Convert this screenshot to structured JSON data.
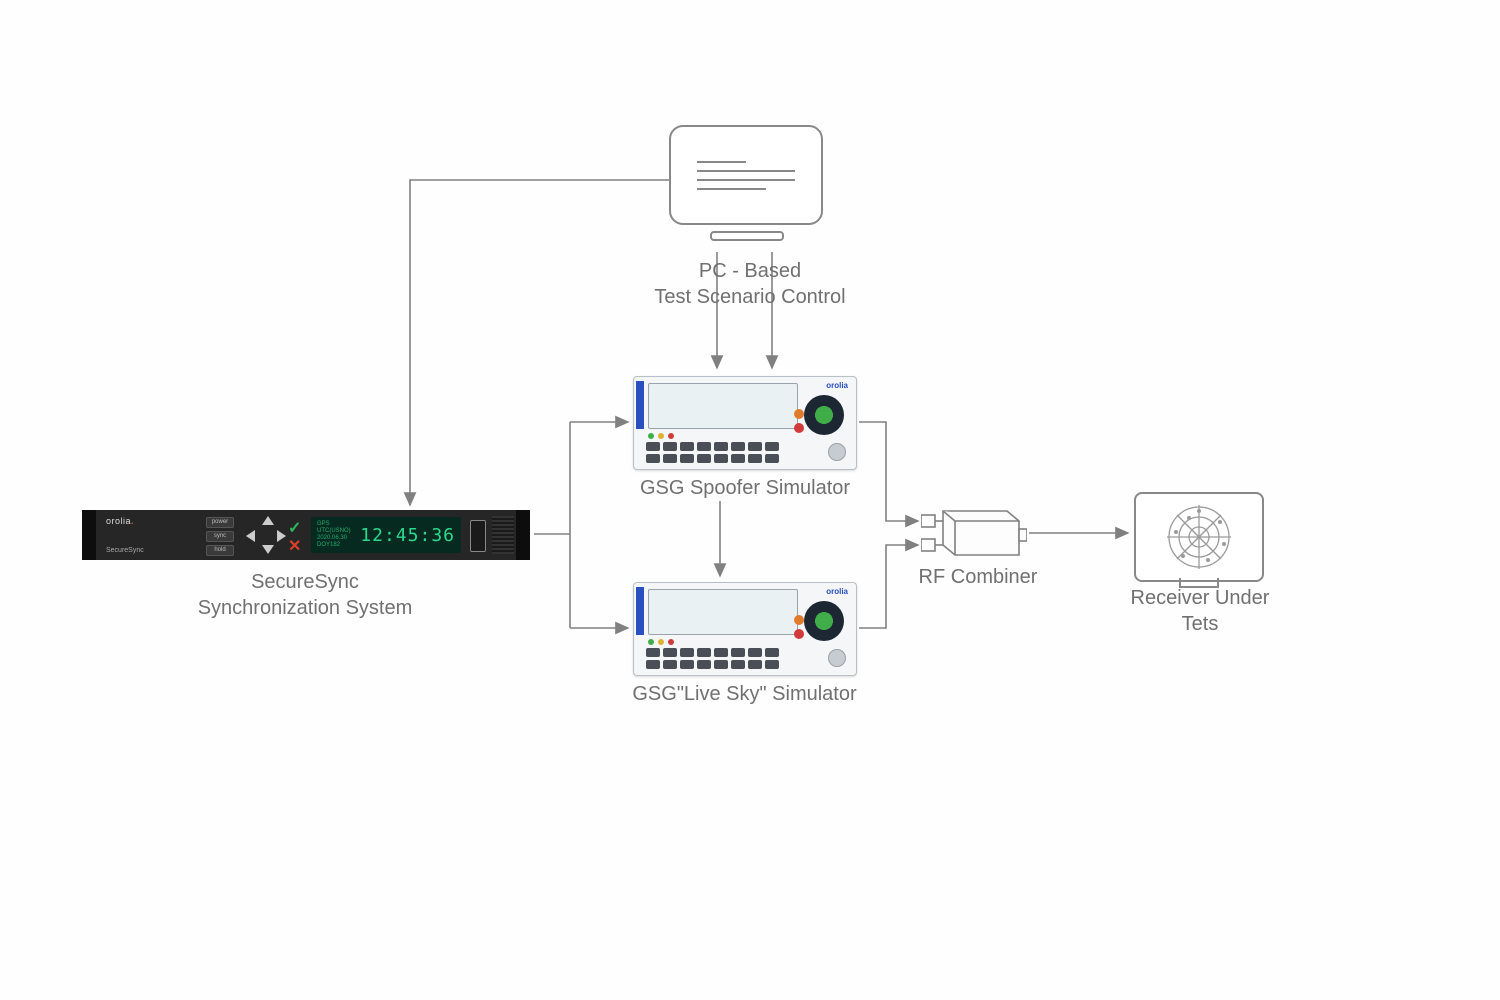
{
  "labels": {
    "pc": "PC - Based\nTest Scenario Control",
    "securesync": "SecureSync\nSynchronization System",
    "spoofer": "GSG Spoofer Simulator",
    "livesky": "GSG\"Live Sky\" Simulator",
    "rfcombiner": "RF Combiner",
    "receiver": "Receiver Under\nTets"
  },
  "rack": {
    "brand": "orolia",
    "model": "SecureSync",
    "buttons": [
      "power",
      "sync",
      "hold"
    ],
    "lcd_small": "GPS  UTC(USNO)\n2020.06.30  DOY182",
    "lcd_time": "12:45:36"
  },
  "gsg": {
    "brand": "orolia"
  },
  "colors": {
    "line": "#808080",
    "text": "#707070"
  }
}
